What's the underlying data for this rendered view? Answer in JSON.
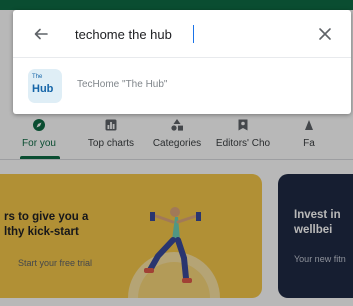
{
  "search": {
    "query": "techome the hub",
    "suggestion_label": "TecHome \"The Hub\"",
    "app_icon_text": "Hub",
    "app_icon_small": "The"
  },
  "tabs": [
    {
      "label": "For you",
      "icon": "compass-icon"
    },
    {
      "label": "Top charts",
      "icon": "chart-icon"
    },
    {
      "label": "Categories",
      "icon": "categories-icon"
    },
    {
      "label": "Editors' Cho",
      "icon": "editors-choice-icon"
    },
    {
      "label": "Fa",
      "icon": "family-icon"
    }
  ],
  "banner": {
    "title_line1": "rs to give you a",
    "title_line2": "lthy kick-start",
    "cta": "Start your free trial"
  },
  "banner2": {
    "title_line1": "Invest in",
    "title_line2": "wellbei",
    "cta": "Your new fitn"
  },
  "colors": {
    "brand_green": "#0f6b45",
    "banner_yellow": "#f6c84a",
    "banner_navy": "#1f2a44"
  }
}
